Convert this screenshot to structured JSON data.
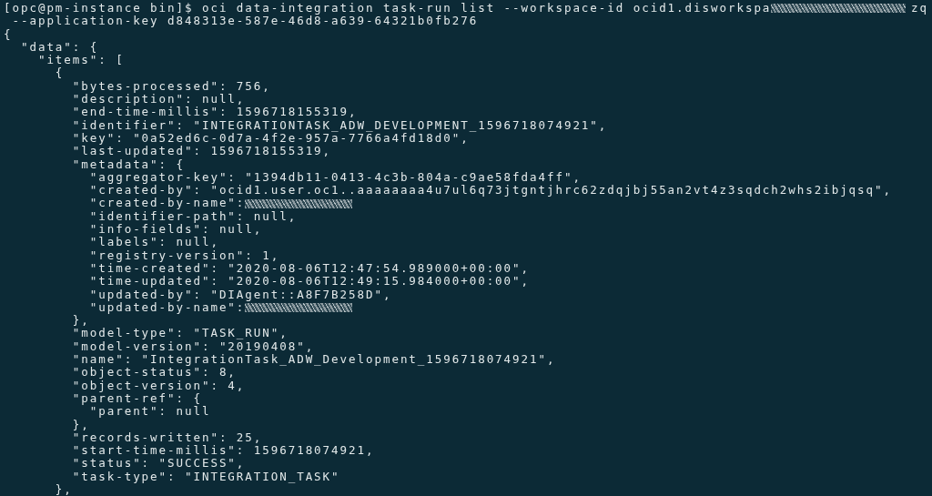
{
  "terminal": {
    "lines": [
      {
        "text": "[opc@pm-instance bin]$ oci data-integration task-run list --workspace-id ocid1.disworkspa",
        "redacted": true,
        "tail": "zq"
      },
      {
        "text": " --application-key d848313e-587e-46d8-a639-64321b0fb276"
      },
      {
        "text": "{"
      },
      {
        "text": "  \"data\": {"
      },
      {
        "text": "    \"items\": ["
      },
      {
        "text": "      {"
      },
      {
        "text": "        \"bytes-processed\": 756,"
      },
      {
        "text": "        \"description\": null,"
      },
      {
        "text": "        \"end-time-millis\": 1596718155319,"
      },
      {
        "text": "        \"identifier\": \"INTEGRATIONTASK_ADW_DEVELOPMENT_1596718074921\","
      },
      {
        "text": "        \"key\": \"0a52ed6c-0d7a-4f2e-957a-7766a4fd18d0\","
      },
      {
        "text": "        \"last-updated\": 1596718155319,"
      },
      {
        "text": "        \"metadata\": {"
      },
      {
        "text": "          \"aggregator-key\": \"1394db11-0413-4c3b-804a-c9ae58fda4ff\","
      },
      {
        "text": "          \"created-by\": \"ocid1.user.oc1..aaaaaaaa4u7ul6q73jtgntjhrc62zdqjbj55an2vt4z3sqdch2whs2ibjqsq\","
      },
      {
        "text": "          \"created-by-name\":",
        "redacted": true
      },
      {
        "text": "          \"identifier-path\": null,"
      },
      {
        "text": "          \"info-fields\": null,"
      },
      {
        "text": "          \"labels\": null,"
      },
      {
        "text": "          \"registry-version\": 1,"
      },
      {
        "text": "          \"time-created\": \"2020-08-06T12:47:54.989000+00:00\","
      },
      {
        "text": "          \"time-updated\": \"2020-08-06T12:49:15.984000+00:00\","
      },
      {
        "text": "          \"updated-by\": \"DIAgent::A8F7B258D\","
      },
      {
        "text": "          \"updated-by-name\":",
        "redacted": true
      },
      {
        "text": "        },"
      },
      {
        "text": "        \"model-type\": \"TASK_RUN\","
      },
      {
        "text": "        \"model-version\": \"20190408\","
      },
      {
        "text": "        \"name\": \"IntegrationTask_ADW_Development_1596718074921\","
      },
      {
        "text": "        \"object-status\": 8,"
      },
      {
        "text": "        \"object-version\": 4,"
      },
      {
        "text": "        \"parent-ref\": {"
      },
      {
        "text": "          \"parent\": null"
      },
      {
        "text": "        },"
      },
      {
        "text": "        \"records-written\": 25,"
      },
      {
        "text": "        \"start-time-millis\": 1596718074921,"
      },
      {
        "text": "        \"status\": \"SUCCESS\","
      },
      {
        "text": "        \"task-type\": \"INTEGRATION_TASK\""
      },
      {
        "text": "      },"
      }
    ]
  }
}
